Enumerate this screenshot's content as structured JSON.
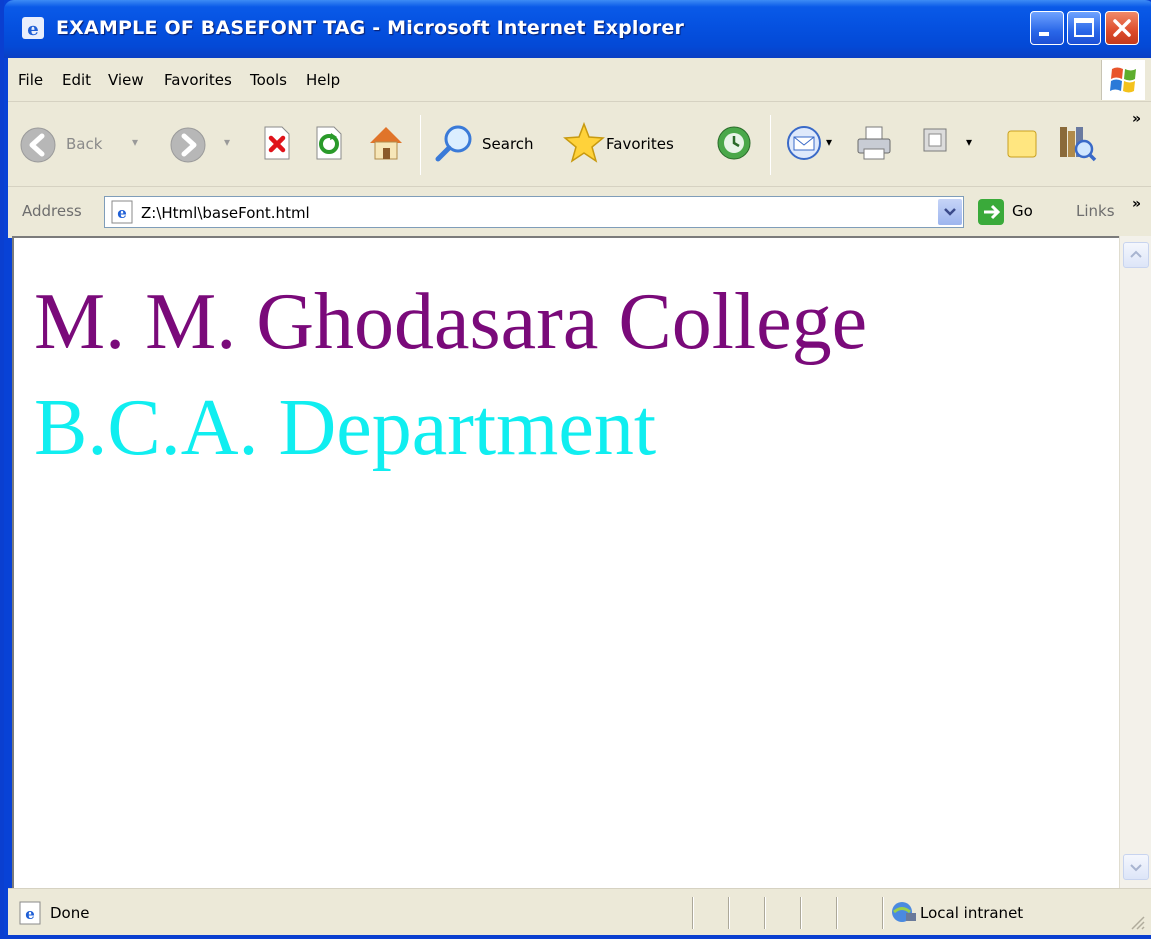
{
  "window": {
    "title": "EXAMPLE OF BASEFONT TAG - Microsoft Internet Explorer"
  },
  "menu": {
    "items": [
      "File",
      "Edit",
      "View",
      "Favorites",
      "Tools",
      "Help"
    ]
  },
  "toolbar": {
    "back_label": "Back",
    "search_label": "Search",
    "favorites_label": "Favorites"
  },
  "address": {
    "label": "Address",
    "url": "Z:\\Html\\baseFont.html",
    "go_label": "Go",
    "links_label": "Links"
  },
  "content": {
    "line1": {
      "text": "M. M. Ghodasara College",
      "color": "#7a0a7a"
    },
    "line2": {
      "text": "B.C.A. Department",
      "color": "#10eef0"
    }
  },
  "status": {
    "text": "Done",
    "zone": "Local intranet"
  },
  "icons": [
    "ie-icon",
    "minimize-icon",
    "maximize-icon",
    "close-icon",
    "windows-logo-icon",
    "back-icon",
    "forward-icon",
    "stop-icon",
    "refresh-icon",
    "home-icon",
    "search-icon",
    "favorites-star-icon",
    "history-icon",
    "mail-icon",
    "print-icon",
    "edit-icon",
    "discuss-icon",
    "research-icon",
    "go-arrow-icon",
    "local-intranet-icon"
  ]
}
